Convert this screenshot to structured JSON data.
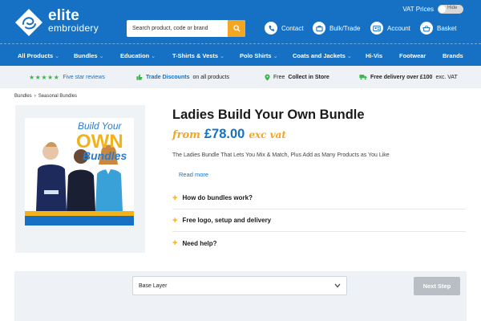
{
  "header": {
    "logo_line1": "elite",
    "logo_line2": "embroidery",
    "vat_label": "VAT Prices",
    "vat_toggle_label": "Hide",
    "search_placeholder": "Search product, code or brand",
    "links": [
      {
        "label": "Contact",
        "icon": "phone-icon"
      },
      {
        "label": "Bulk/Trade",
        "icon": "briefcase-icon"
      },
      {
        "label": "Account",
        "icon": "user-card-icon"
      },
      {
        "label": "Basket",
        "icon": "basket-icon"
      }
    ]
  },
  "nav": {
    "items": [
      {
        "label": "All Products",
        "dropdown": true
      },
      {
        "label": "Bundles",
        "dropdown": true
      },
      {
        "label": "Education",
        "dropdown": true
      },
      {
        "label": "T-Shirts & Vests",
        "dropdown": true
      },
      {
        "label": "Polo Shirts",
        "dropdown": true
      },
      {
        "label": "Coats and Jackets",
        "dropdown": true
      },
      {
        "label": "Hi-Vis",
        "dropdown": false
      },
      {
        "label": "Footwear",
        "dropdown": false
      },
      {
        "label": "Brands",
        "dropdown": false
      }
    ]
  },
  "infobar": {
    "stars": "★★★★★",
    "five_star": "Five star reviews",
    "trade_bold": "Trade Discounts",
    "trade_rest": "on all products",
    "collect_pre": "Free",
    "collect_bold": "Collect in Store",
    "delivery_bold": "Free delivery over £100",
    "delivery_rest": "exc. VAT"
  },
  "breadcrumb": {
    "items": [
      "Bundles",
      "Seasonal Bundles"
    ],
    "separator": "›"
  },
  "product": {
    "image_text_line1": "Build Your",
    "image_text_line2": "OWN",
    "image_text_line3": "Bundles",
    "title": "Ladies Build Your Own Bundle",
    "price_from": "from",
    "price_amount": "£78.00",
    "price_exvat": "exc vat",
    "description": "The Ladies Bundle That Lets You Mix & Match, Plus Add as Many Products as You Like",
    "read_more": "Read more",
    "accordion": [
      {
        "label": "How do bundles work?"
      },
      {
        "label": "Free logo, setup and delivery"
      },
      {
        "label": "Need help?"
      }
    ]
  },
  "builder": {
    "select_value": "Base Layer",
    "next_label": "Next Step"
  },
  "colors": {
    "brand_blue": "#1671c4",
    "accent_orange": "#f2a623",
    "star_green": "#3bb54a",
    "panel_grey": "#eef2f7"
  }
}
